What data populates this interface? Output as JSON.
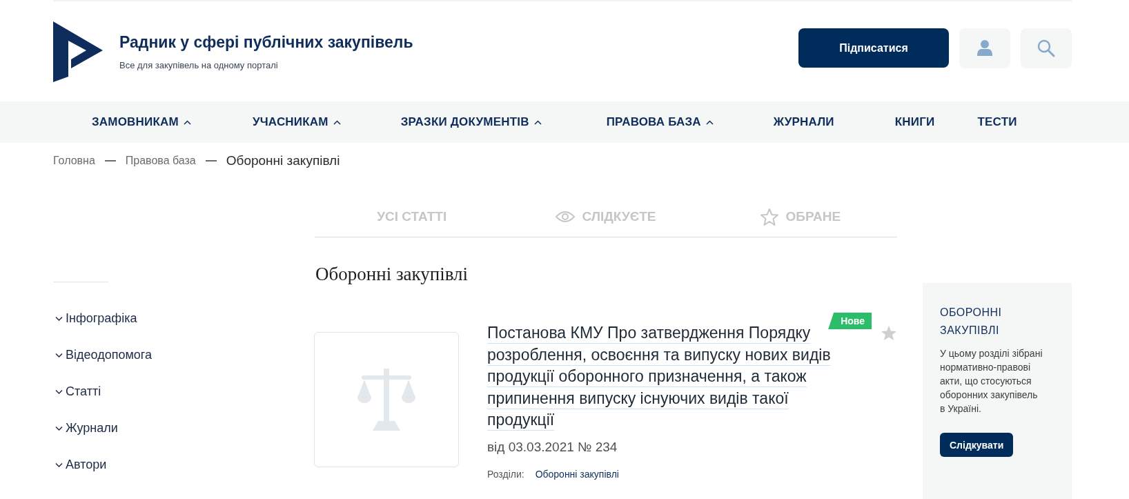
{
  "header": {
    "site_title": "Радник у сфері публічних закупівель",
    "tagline": "Все для закупівель на одному порталі",
    "subscribe_button": "Підписатися"
  },
  "nav": [
    {
      "label": "ЗАМОВНИКАМ",
      "dropdown": true
    },
    {
      "label": "УЧАСНИКАМ",
      "dropdown": true
    },
    {
      "label": "ЗРАЗКИ ДОКУМЕНТІВ",
      "dropdown": true
    },
    {
      "label": "ПРАВОВА БАЗА",
      "dropdown": true
    },
    {
      "label": "ЖУРНАЛИ",
      "dropdown": false
    },
    {
      "label": "КНИГИ",
      "dropdown": false
    },
    {
      "label": "ТЕСТИ",
      "dropdown": false
    }
  ],
  "breadcrumbs": [
    {
      "label": "Головна",
      "current": false
    },
    {
      "label": "Правова база",
      "current": false
    },
    {
      "label": "Оборонні закупівлі",
      "current": true
    }
  ],
  "tabs": [
    {
      "label": "УСІ СТАТТІ",
      "kind": "all",
      "selected": false
    },
    {
      "label": "СЛІДКУЄТЕ",
      "kind": "watch",
      "selected": false
    },
    {
      "label": "ОБРАНЕ",
      "kind": "favorites",
      "selected": false
    }
  ],
  "sidebar": {
    "items": [
      {
        "label": "Інфографіка",
        "expanded": false
      },
      {
        "label": "Відеодопомога",
        "expanded": false
      },
      {
        "label": "Статті",
        "expanded": false
      },
      {
        "label": "Журнали",
        "expanded": false
      },
      {
        "label": "Автори",
        "expanded": false
      }
    ]
  },
  "heading": "Оборонні закупівлі",
  "articles": [
    {
      "badge": "Нове",
      "title": "Постанова КМУ Про затвердження Порядку розроблення, освоєння та випуску нових видів продукції оборонного призначення, а також припинення випуску існуючих видів такої продукції",
      "date": "від 03.03.2021 № 234",
      "sections_label": "Розділи:",
      "sections": [
        "Оборонні закупівлі"
      ],
      "favorite": false
    }
  ],
  "aside": {
    "title": "ОБОРОННІ ЗАКУПІВЛІ",
    "text": "У цьому розділі зібрані нормативно-правові акти, що стосуються оборонних закупівель в Україні.",
    "button": "Слідкувати"
  }
}
